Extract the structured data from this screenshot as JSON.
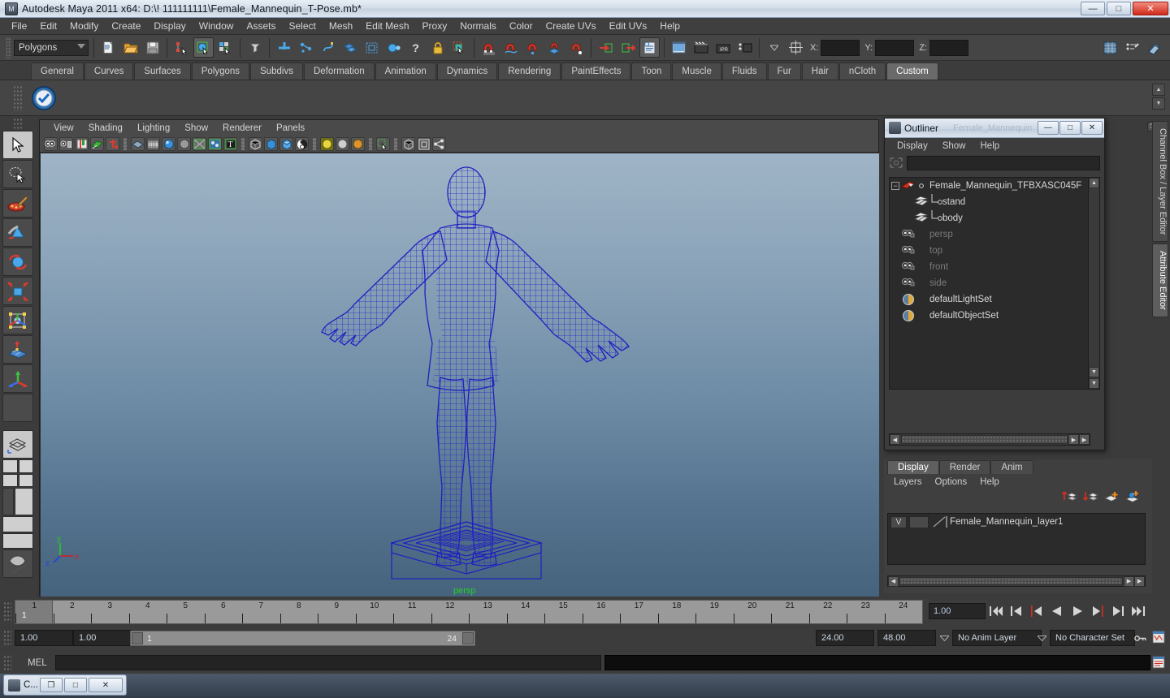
{
  "window": {
    "title": "Autodesk Maya 2011 x64: D:\\! 111111111\\Female_Mannequin_T-Pose.mb*",
    "app_icon": "maya-icon",
    "minimize": "—",
    "maximize": "□",
    "close": "✕"
  },
  "menubar": {
    "items": [
      "File",
      "Edit",
      "Modify",
      "Create",
      "Display",
      "Window",
      "Assets",
      "Select",
      "Mesh",
      "Edit Mesh",
      "Proxy",
      "Normals",
      "Color",
      "Create UVs",
      "Edit UVs",
      "Help"
    ]
  },
  "statusbar": {
    "mode": "Polygons",
    "axis_labels": {
      "x": "X:",
      "y": "Y:",
      "z": "Z:"
    },
    "x_value": "",
    "y_value": "",
    "z_value": "",
    "icons": [
      "new-scene-icon",
      "open-scene-icon",
      "save-scene-icon",
      "select-by-hierarchy-icon",
      "select-by-object-icon",
      "select-by-component-icon",
      "select-mask-icon",
      "snap-grid-icon",
      "snap-curve-icon",
      "snap-point-icon",
      "snap-view-plane-icon",
      "snap-live-icon",
      "input-connections-icon",
      "output-connections-icon",
      "construction-history-icon",
      "render-current-frame-icon",
      "ipr-render-icon",
      "render-settings-icon",
      "help-icon",
      "lock-icon",
      "selection-highlight-icon",
      "show-manipulator-icon",
      "render-view-icon"
    ],
    "right_icons": [
      "channel-box-icon",
      "attribute-editor-icon",
      "tool-settings-icon"
    ]
  },
  "shelf": {
    "tabs": [
      "General",
      "Curves",
      "Surfaces",
      "Polygons",
      "Subdivs",
      "Deformation",
      "Animation",
      "Dynamics",
      "Rendering",
      "PaintEffects",
      "Toon",
      "Muscle",
      "Fluids",
      "Fur",
      "Hair",
      "nCloth",
      "Custom"
    ],
    "active_tab": "Custom",
    "items": [
      {
        "name": "custom-check-icon",
        "glyph": "✔"
      }
    ]
  },
  "toolbox": {
    "items": [
      {
        "name": "select-tool",
        "label": "Select Tool",
        "selected": true
      },
      {
        "name": "lasso-select-tool",
        "label": "Lasso Select Tool",
        "selected": false
      },
      {
        "name": "paint-select-tool",
        "label": "Paint Select Tool",
        "selected": false
      },
      {
        "name": "move-tool",
        "label": "Move Tool",
        "selected": false
      },
      {
        "name": "rotate-tool",
        "label": "Rotate Tool",
        "selected": false
      },
      {
        "name": "scale-tool",
        "label": "Scale Tool",
        "selected": false
      },
      {
        "name": "universal-manipulator-tool",
        "label": "Universal Manipulator",
        "selected": false
      },
      {
        "name": "soft-modification-tool",
        "label": "Soft Modification Tool",
        "selected": false
      },
      {
        "name": "show-manipulator-tool",
        "label": "Show Manipulator Tool",
        "selected": false
      },
      {
        "name": "last-tool-used",
        "label": "Last Tool Used",
        "selected": false
      }
    ],
    "layouts": [
      {
        "name": "single-perspective-layout-icon"
      },
      {
        "name": "four-view-layout-icon"
      },
      {
        "name": "outliner-persp-layout-icon"
      },
      {
        "name": "persp-graph-layout-icon"
      },
      {
        "name": "hypershade-persp-layout-icon"
      }
    ]
  },
  "viewport": {
    "menus": [
      "View",
      "Shading",
      "Lighting",
      "Show",
      "Renderer",
      "Panels"
    ],
    "toolbar_icons": [
      "select-camera-icon",
      "camera-attributes-icon",
      "bookmark-icon",
      "image-plane-icon",
      "keyframe-icon",
      "resolution-gate-icon",
      "film-gate-icon",
      "smooth-shade-icon",
      "wireframe-on-shaded-icon",
      "texture-icon",
      "lights-icon",
      "text-icon",
      "shadows-icon",
      "xray-icon",
      "xray-joints-icon",
      "grid-icon",
      "two-sided-lighting-icon",
      "default-light-icon",
      "all-lights-icon",
      "isolate-select-icon",
      "hud-icon",
      "shape-panel-icon",
      "share-icon"
    ],
    "camera_label": "persp",
    "axis": {
      "x": "x",
      "y": "y",
      "z": "z"
    },
    "model": "female-mannequin-wireframe"
  },
  "outliner": {
    "title": "Outliner",
    "title_ghost": "Female_Mannequin",
    "menus": [
      "Display",
      "Show",
      "Help"
    ],
    "search_value": "",
    "win_buttons": {
      "minimize": "—",
      "maximize": "□",
      "close": "✕"
    },
    "rows": [
      {
        "label": "Female_Mannequin_TFBXASC045F",
        "icon": "transform-icon",
        "indent": 0,
        "dim": false,
        "expander": "−",
        "connector": false
      },
      {
        "label": "stand",
        "icon": "mesh-icon",
        "indent": 1,
        "dim": false,
        "expander": "",
        "connector": true
      },
      {
        "label": "body",
        "icon": "mesh-icon",
        "indent": 1,
        "dim": false,
        "expander": "",
        "connector": true
      },
      {
        "label": "persp",
        "icon": "camera-icon",
        "indent": 0,
        "dim": true,
        "expander": "",
        "connector": false
      },
      {
        "label": "top",
        "icon": "camera-icon",
        "indent": 0,
        "dim": true,
        "expander": "",
        "connector": false
      },
      {
        "label": "front",
        "icon": "camera-icon",
        "indent": 0,
        "dim": true,
        "expander": "",
        "connector": false
      },
      {
        "label": "side",
        "icon": "camera-icon",
        "indent": 0,
        "dim": true,
        "expander": "",
        "connector": false
      },
      {
        "label": "defaultLightSet",
        "icon": "set-icon",
        "indent": 0,
        "dim": false,
        "expander": "",
        "connector": false
      },
      {
        "label": "defaultObjectSet",
        "icon": "set-icon",
        "indent": 0,
        "dim": false,
        "expander": "",
        "connector": false
      }
    ]
  },
  "layer_editor": {
    "tabs": [
      "Display",
      "Render",
      "Anim"
    ],
    "active_tab": "Display",
    "menus": [
      "Layers",
      "Options",
      "Help"
    ],
    "toolbar_icons": [
      "move-layer-up-icon",
      "move-layer-down-icon",
      "new-layer-icon",
      "new-layer-from-selected-icon"
    ],
    "layers": [
      {
        "visibility": "V",
        "display_type": "",
        "name": "Female_Mannequin_layer1",
        "color": "#9a9a9a"
      }
    ]
  },
  "right_dock": {
    "tabs": [
      "Channel Box / Layer Editor",
      "Attribute Editor"
    ],
    "active_tab": "Attribute Editor"
  },
  "timeline": {
    "frames": [
      1,
      2,
      3,
      4,
      5,
      6,
      7,
      8,
      9,
      10,
      11,
      12,
      13,
      14,
      15,
      16,
      17,
      18,
      19,
      20,
      21,
      22,
      23,
      24
    ],
    "current_frame_label": "1",
    "current_time_value": "1.00",
    "playback_buttons": [
      {
        "name": "go-to-start-button",
        "glyph": "|◀◀"
      },
      {
        "name": "step-back-key-button",
        "glyph": "|◀"
      },
      {
        "name": "step-back-frame-button",
        "glyph": "◀|"
      },
      {
        "name": "play-backwards-button",
        "glyph": "◀"
      },
      {
        "name": "play-forwards-button",
        "glyph": "▶"
      },
      {
        "name": "step-forward-frame-button",
        "glyph": "▶|"
      },
      {
        "name": "step-forward-key-button",
        "glyph": "▶|"
      },
      {
        "name": "go-to-end-button",
        "glyph": "▶▶|"
      }
    ]
  },
  "range_slider": {
    "start_field": "1.00",
    "end_field": "1.00",
    "range_start_label": "1",
    "range_end_label": "24",
    "playback_start": "24.00",
    "playback_end": "48.00",
    "anim_layer": "No Anim Layer",
    "character_set": "No Character Set",
    "key_icon": "auto-keyframe-icon",
    "prefs_icon": "animation-preferences-icon"
  },
  "command_line": {
    "language": "MEL",
    "input_value": "",
    "output_value": "",
    "script_editor_icon": "script-editor-icon"
  },
  "taskbar": {
    "window_label": "C...",
    "buttons": {
      "restore": "❐",
      "maximize": "□",
      "close": "✕"
    }
  },
  "colors": {
    "accent_blue": "#2b2bd8",
    "viewport_top": "#9fb4c6",
    "viewport_bottom": "#46637d",
    "persp_green": "#21d321",
    "panel_bg": "#3c3c3c"
  }
}
